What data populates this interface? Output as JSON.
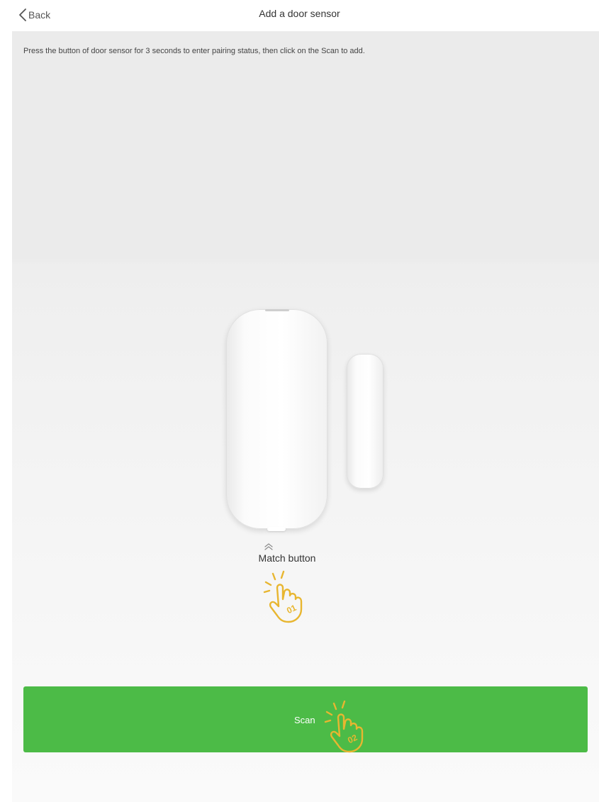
{
  "header": {
    "back_label": "Back",
    "title": "Add a door sensor"
  },
  "instructions": "Press the button of door sensor for 3 seconds to enter pairing status, then click on the Scan to add.",
  "device": {
    "match_button_label": "Match button",
    "step1_badge": "01"
  },
  "scan": {
    "label": "Scan",
    "step2_badge": "02"
  },
  "colors": {
    "accent_green": "#4cbb47",
    "hand_yellow": "#e8b630",
    "background_gray": "#ebebeb"
  },
  "icons": {
    "back": "chevron-left-icon",
    "match_pointer": "double-chevron-up-icon",
    "step_hand": "tap-hand-icon"
  }
}
